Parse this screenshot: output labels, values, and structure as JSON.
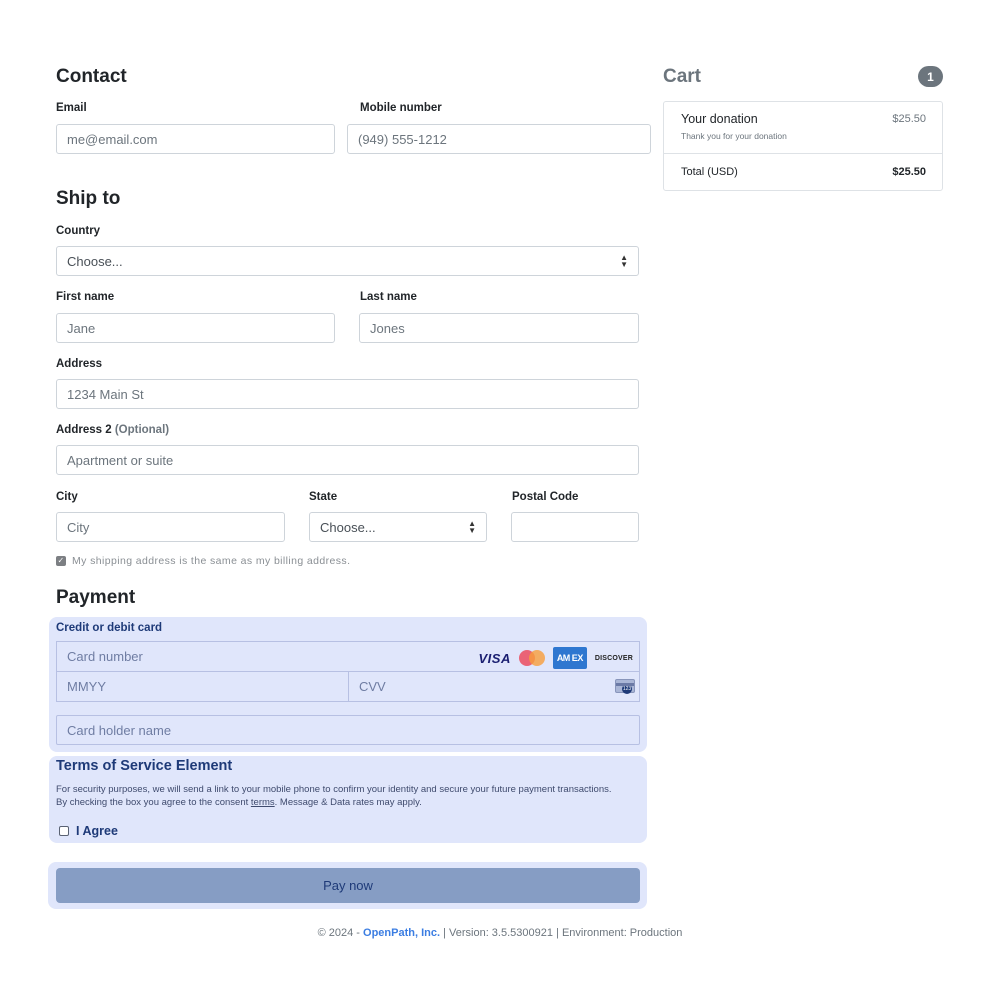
{
  "contact": {
    "heading": "Contact",
    "email_label": "Email",
    "email_placeholder": "me@email.com",
    "mobile_label": "Mobile number",
    "mobile_placeholder": "(949) 555-1212"
  },
  "ship": {
    "heading": "Ship to",
    "country_label": "Country",
    "country_value": "Choose...",
    "first_name_label": "First name",
    "first_name_placeholder": "Jane",
    "last_name_label": "Last name",
    "last_name_placeholder": "Jones",
    "address_label": "Address",
    "address_placeholder": "1234 Main St",
    "address2_label": "Address 2",
    "address2_optional": "(Optional)",
    "address2_placeholder": "Apartment or suite",
    "city_label": "City",
    "city_placeholder": "City",
    "state_label": "State",
    "state_value": "Choose...",
    "postal_label": "Postal Code",
    "postal_placeholder": "",
    "same_address_text": "My shipping address is the same as my billing address.",
    "same_address_checked": true
  },
  "payment": {
    "heading": "Payment",
    "card_section_title": "Credit or debit card",
    "card_number_placeholder": "Card number",
    "expiry_placeholder": "MMYY",
    "cvv_placeholder": "CVV",
    "cvv_icon_text": "123",
    "card_holder_placeholder": "Card holder name",
    "brands": {
      "visa": "VISA",
      "amex": "AM EX",
      "discover": "DISCOVER",
      "mc_colors": [
        "#eb4b5e",
        "#f79e3b"
      ]
    }
  },
  "tos": {
    "title": "Terms of Service Element",
    "text_before": "For security purposes, we will send a link to your mobile phone to confirm your identity and secure your future payment transactions. By checking the box you agree to the consent ",
    "terms_link": "terms",
    "text_after": ". Message & Data rates may apply.",
    "agree_label": "I Agree",
    "agree_checked": false
  },
  "pay_button": "Pay now",
  "footer": {
    "prefix": "© 2024 - ",
    "company": "OpenPath, Inc.",
    "rest": " | Version: 3.5.5300921 | Environment: Production"
  },
  "cart": {
    "title": "Cart",
    "count": "1",
    "item_name": "Your donation",
    "item_desc": "Thank you for your donation",
    "item_price": "$25.50",
    "total_label": "Total (USD)",
    "total_value": "$25.50"
  },
  "colors": {
    "panel_bg": "#e0e6fb",
    "accent_text": "#1e3a78",
    "pay_button_bg": "#869dc4",
    "footer_link": "#3b7de2",
    "badge_bg": "#6c757d"
  }
}
